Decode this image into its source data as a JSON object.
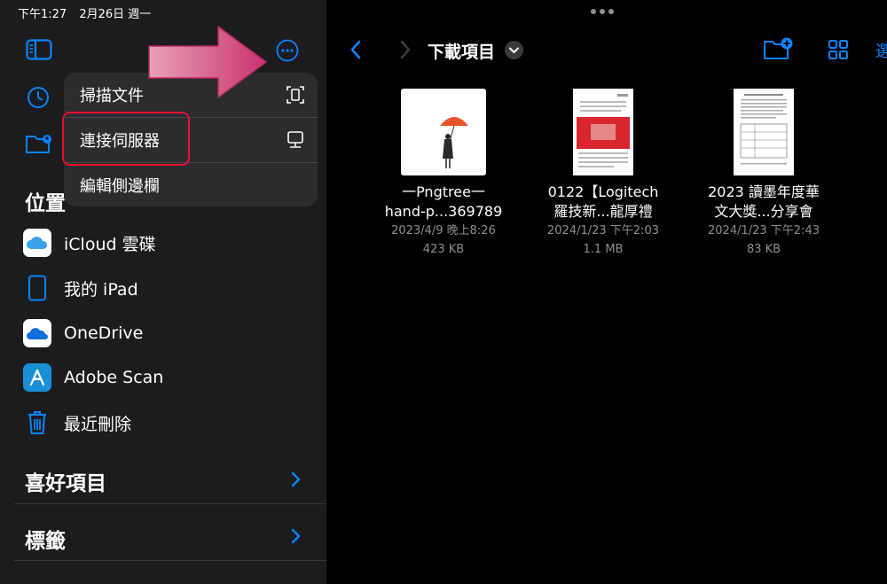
{
  "status_bar": {
    "time": "下午1:27",
    "date": "2月26日 週一"
  },
  "sidebar": {
    "section_locations": "位置",
    "locations": [
      {
        "label": "iCloud 雲碟",
        "icon": "icloud-icon"
      },
      {
        "label": "我的 iPad",
        "icon": "ipad-icon"
      },
      {
        "label": "OneDrive",
        "icon": "onedrive-icon"
      },
      {
        "label": "Adobe Scan",
        "icon": "adobe-scan-icon"
      },
      {
        "label": "最近刪除",
        "icon": "trash-icon"
      }
    ],
    "section_favorites": "喜好項目",
    "section_tags": "標籤"
  },
  "menu": {
    "items": [
      {
        "label": "掃描文件",
        "icon": "scan-document-icon"
      },
      {
        "label": "連接伺服器",
        "icon": "server-icon"
      },
      {
        "label": "編輯側邊欄",
        "icon": ""
      }
    ]
  },
  "main": {
    "folder_title": "下載項目",
    "select_label": "選",
    "files": [
      {
        "name_line1": "一Pngtree一",
        "name_line2": "hand-p...369789",
        "date": "2023/4/9 晚上8:26",
        "size": "423 KB"
      },
      {
        "name_line1": "0122【Logitech",
        "name_line2": "羅技新...龍厚禮",
        "date": "2024/1/23 下午2:03",
        "size": "1.1 MB"
      },
      {
        "name_line1": "2023 讀墨年度華",
        "name_line2": "文大獎...分享會",
        "date": "2024/1/23 下午2:43",
        "size": "83 KB"
      }
    ]
  },
  "colors": {
    "accent": "#0a84ff",
    "sidebar_bg": "#1c1c1e",
    "menu_bg": "#2c2c2e",
    "highlight": "#e8112d",
    "annotation_arrow": "#d4407a"
  }
}
